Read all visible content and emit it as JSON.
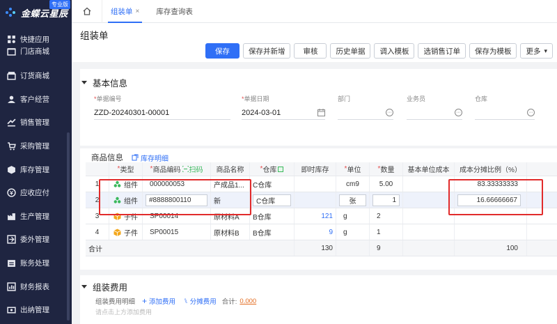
{
  "app": {
    "logo_text": "金蝶云星辰",
    "edition_badge": "专业版"
  },
  "sidebar": {
    "items": [
      {
        "label": "快捷应用",
        "icon": "grid-icon"
      },
      {
        "label": "门店商城",
        "icon": "store-icon"
      },
      {
        "label": "订货商城",
        "icon": "shop-icon"
      },
      {
        "label": "客户经营",
        "icon": "customer-icon"
      },
      {
        "label": "销售管理",
        "icon": "sales-icon"
      },
      {
        "label": "采购管理",
        "icon": "cart-icon"
      },
      {
        "label": "库存管理",
        "icon": "box-icon"
      },
      {
        "label": "应收应付",
        "icon": "coin-icon"
      },
      {
        "label": "生产管理",
        "icon": "factory-icon"
      },
      {
        "label": "委外管理",
        "icon": "outsource-icon"
      },
      {
        "label": "账务处理",
        "icon": "ledger-icon"
      },
      {
        "label": "财务报表",
        "icon": "report-icon"
      },
      {
        "label": "出纳管理",
        "icon": "cashier-icon"
      }
    ]
  },
  "tabs": [
    {
      "label": "组装单",
      "active": true,
      "closable": true
    },
    {
      "label": "库存查询表",
      "active": false,
      "closable": false
    }
  ],
  "page": {
    "title": "组装单"
  },
  "toolbar": {
    "buttons": [
      "保存",
      "保存并新增",
      "审核",
      "历史单据",
      "调入模板",
      "选销售订单",
      "保存为模板",
      "更多"
    ]
  },
  "basic": {
    "title": "基本信息",
    "fields": [
      {
        "label": "单据编号",
        "required": true,
        "value": ""
      },
      {
        "label": "单据日期",
        "required": true,
        "value": ""
      },
      {
        "label": "部门",
        "required": false,
        "value": ""
      },
      {
        "label": "业务员",
        "required": false,
        "value": ""
      },
      {
        "label": "仓库",
        "required": false,
        "value": ""
      }
    ],
    "doc_no": "ZZD-20240301-00001",
    "doc_date": "2024-03-01"
  },
  "products": {
    "title": "商品信息",
    "stock_detail_link": "库存明细",
    "scan_label": "扫码",
    "columns": [
      "",
      "*类型",
      "*商品编码",
      "商品名称",
      "*仓库",
      "即时库存",
      "*单位",
      "*数量",
      "基本单位成本",
      "成本分摊比例（%）"
    ],
    "rows": [
      {
        "no": "1",
        "type": "组件",
        "code": "000000053",
        "name": "产成品1...",
        "warehouse": "C仓库",
        "stock": "",
        "unit": "cm9",
        "qty": "5.00",
        "base_cost": "",
        "ratio": "83.33333333",
        "type_icon": "assembly-icon"
      },
      {
        "no": "2",
        "type": "组件",
        "code": "#8888800110",
        "name": "新",
        "warehouse": "C仓库",
        "stock": "",
        "unit": "张",
        "qty": "1",
        "base_cost": "",
        "ratio": "16.66666667",
        "type_icon": "assembly-icon"
      },
      {
        "no": "3",
        "type": "子件",
        "code": "SP00014",
        "name": "原材料A",
        "warehouse": "B仓库",
        "stock": "121",
        "unit": "g",
        "qty": "2",
        "base_cost": "",
        "ratio": "",
        "type_icon": "cube-icon"
      },
      {
        "no": "4",
        "type": "子件",
        "code": "SP00015",
        "name": "原材料B",
        "warehouse": "B仓库",
        "stock": "9",
        "unit": "g",
        "qty": "1",
        "base_cost": "",
        "ratio": "",
        "type_icon": "cube-icon"
      }
    ],
    "total": {
      "label": "合计",
      "stock": "130",
      "qty": "9",
      "ratio": "100"
    }
  },
  "fees": {
    "title": "组装费用",
    "detail_label": "组装费用明细",
    "add_fee": "添加费用",
    "split_fee": "分摊费用",
    "total_label": "合计:",
    "total_value": "0.000",
    "hint": "请点击上方添加费用"
  },
  "colors": {
    "accent": "#2f6ff6",
    "sidebar_bg": "#1f2541",
    "highlight": "#e12b2b"
  }
}
